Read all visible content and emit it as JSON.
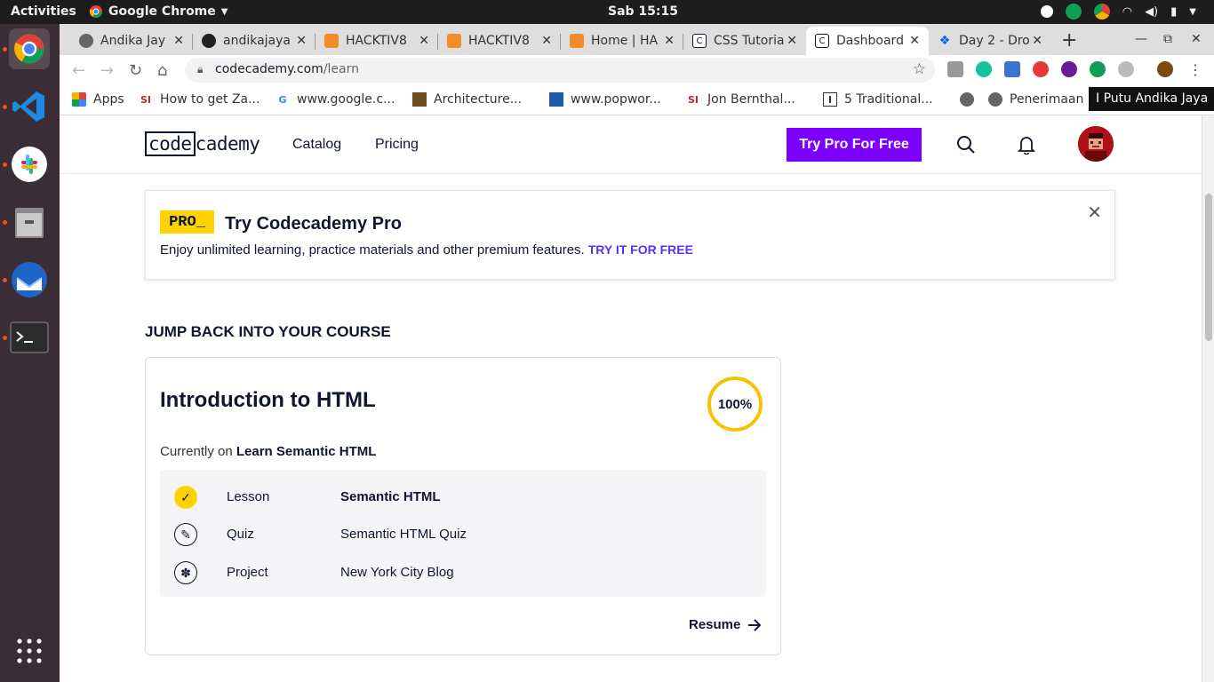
{
  "system": {
    "activities": "Activities",
    "app_name": "Google Chrome",
    "clock": "Sab 15:15"
  },
  "tabs": [
    {
      "title": "Andika Jay",
      "icon": "globe-icon"
    },
    {
      "title": "andikajaya",
      "icon": "github-icon"
    },
    {
      "title": "HACKTIV8",
      "icon": "hacktiv8-icon"
    },
    {
      "title": "HACKTIV8",
      "icon": "hacktiv8-icon"
    },
    {
      "title": "Home | HA",
      "icon": "hacktiv8-icon"
    },
    {
      "title": "CSS Tutoria",
      "icon": "codecademy-icon"
    },
    {
      "title": "Dashboard",
      "icon": "codecademy-icon",
      "active": true
    },
    {
      "title": "Day 2 - Dro",
      "icon": "dropbox-icon"
    }
  ],
  "address": {
    "host": "codecademy.com",
    "path": "/learn"
  },
  "bookmarks": [
    {
      "label": "Apps",
      "icon": "apps-grid-icon"
    },
    {
      "label": "How to get Za...",
      "icon": "sii-icon"
    },
    {
      "label": "www.google.c...",
      "icon": "google-icon"
    },
    {
      "label": "Architecture...",
      "icon": "architecture-icon"
    },
    {
      "label": "www.popwor...",
      "icon": "popworld-icon"
    },
    {
      "label": "Jon Bernthal...",
      "icon": "sii-icon"
    },
    {
      "label": "5 Traditional...",
      "icon": "instructables-icon"
    },
    {
      "label": "",
      "icon": "globe-icon"
    },
    {
      "label": "Penerimaan E",
      "icon": "globe-icon"
    }
  ],
  "tooltip": "I Putu Andika Jaya",
  "site": {
    "logo_boxed": "code",
    "logo_rest": "cademy",
    "nav": {
      "catalog": "Catalog",
      "pricing": "Pricing"
    },
    "cta": "Try Pro For Free"
  },
  "banner": {
    "badge": "PRO_",
    "title": "Try Codecademy Pro",
    "text": "Enjoy unlimited learning, practice materials and other premium features.",
    "link": "TRY IT FOR FREE"
  },
  "course_section": {
    "heading": "JUMP BACK INTO YOUR COURSE",
    "course_title": "Introduction to HTML",
    "progress_label": "100%",
    "progress": 1.0,
    "current_prefix": "Currently on",
    "current_module": "Learn Semantic HTML",
    "steps": [
      {
        "type": "Lesson",
        "name": "Semantic HTML",
        "icon": "check-icon",
        "done": true
      },
      {
        "type": "Quiz",
        "name": "Semantic HTML Quiz",
        "icon": "quiz-pencil-icon",
        "done": false
      },
      {
        "type": "Project",
        "name": "New York City Blog",
        "icon": "puzzle-icon",
        "done": false
      }
    ],
    "resume": "Resume"
  },
  "colors": {
    "brand_purple": "#7b00ff",
    "pro_yellow": "#ffd300",
    "link_blue": "#5533ff",
    "progress_yellow": "#f5c400",
    "navy": "#10162f"
  }
}
